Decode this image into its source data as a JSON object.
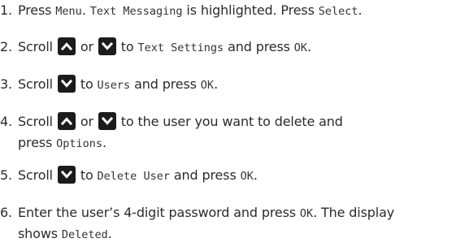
{
  "steps": [
    {
      "number": "1.",
      "lines": [
        [
          {
            "t": "text",
            "v": "Press "
          },
          {
            "t": "mono",
            "v": "Menu"
          },
          {
            "t": "text",
            "v": ". "
          },
          {
            "t": "mono",
            "v": "Text Messaging"
          },
          {
            "t": "text",
            "v": " is highlighted. Press "
          },
          {
            "t": "mono",
            "v": "Select"
          },
          {
            "t": "text",
            "v": "."
          }
        ]
      ]
    },
    {
      "number": "2.",
      "lines": [
        [
          {
            "t": "text",
            "v": "Scroll "
          },
          {
            "t": "key",
            "v": "up-arrow-icon"
          },
          {
            "t": "text",
            "v": " or "
          },
          {
            "t": "key",
            "v": "down-arrow-icon"
          },
          {
            "t": "text",
            "v": " to "
          },
          {
            "t": "mono",
            "v": "Text Settings"
          },
          {
            "t": "text",
            "v": " and press "
          },
          {
            "t": "mono",
            "v": "OK"
          },
          {
            "t": "text",
            "v": "."
          }
        ]
      ]
    },
    {
      "number": "3.",
      "lines": [
        [
          {
            "t": "text",
            "v": "Scroll "
          },
          {
            "t": "key",
            "v": "down-arrow-icon"
          },
          {
            "t": "text",
            "v": " to "
          },
          {
            "t": "mono",
            "v": "Users"
          },
          {
            "t": "text",
            "v": " and press "
          },
          {
            "t": "mono",
            "v": "OK"
          },
          {
            "t": "text",
            "v": "."
          }
        ]
      ]
    },
    {
      "number": "4.",
      "lines": [
        [
          {
            "t": "text",
            "v": "Scroll "
          },
          {
            "t": "key",
            "v": "up-arrow-icon"
          },
          {
            "t": "text",
            "v": " or "
          },
          {
            "t": "key",
            "v": "down-arrow-icon"
          },
          {
            "t": "text",
            "v": " to the user you want to delete and"
          }
        ],
        [
          {
            "t": "text",
            "v": "press "
          },
          {
            "t": "mono",
            "v": "Options"
          },
          {
            "t": "text",
            "v": "."
          }
        ]
      ]
    },
    {
      "number": "5.",
      "lines": [
        [
          {
            "t": "text",
            "v": "Scroll "
          },
          {
            "t": "key",
            "v": "down-arrow-icon"
          },
          {
            "t": "text",
            "v": " to "
          },
          {
            "t": "mono",
            "v": "Delete User"
          },
          {
            "t": "text",
            "v": " and press "
          },
          {
            "t": "mono",
            "v": "OK"
          },
          {
            "t": "text",
            "v": "."
          }
        ]
      ]
    },
    {
      "number": "6.",
      "lines": [
        [
          {
            "t": "text",
            "v": "Enter the user’s 4-digit password and press "
          },
          {
            "t": "mono",
            "v": "OK"
          },
          {
            "t": "text",
            "v": ". The display"
          }
        ],
        [
          {
            "t": "text",
            "v": "shows "
          },
          {
            "t": "mono",
            "v": "Deleted"
          },
          {
            "t": "text",
            "v": "."
          }
        ]
      ]
    }
  ],
  "colors": {
    "text": "#2b2b2b",
    "key_background": "#1c1c1c",
    "key_arrow": "#ffffff"
  }
}
